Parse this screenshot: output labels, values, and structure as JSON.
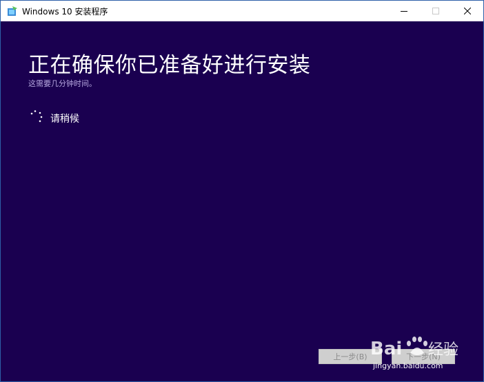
{
  "window": {
    "title": "Windows 10 安装程序",
    "controls": {
      "minimize_icon": "minimize-icon",
      "maximize_icon": "maximize-icon",
      "close_icon": "close-icon"
    }
  },
  "main": {
    "heading": "正在确保你已准备好进行安装",
    "subheading": "这需要几分钟时间。",
    "status_text": "请稍候"
  },
  "footer": {
    "back_label": "上一步(B)",
    "next_label": "下一步(N)"
  },
  "watermark": {
    "brand": "Bai",
    "brand_suffix": "经验",
    "url": "jingyan.baidu.com"
  },
  "colors": {
    "background": "#1a0050",
    "titlebar": "#ffffff",
    "heading": "#ffffff",
    "subheading": "#b7a9e0"
  }
}
